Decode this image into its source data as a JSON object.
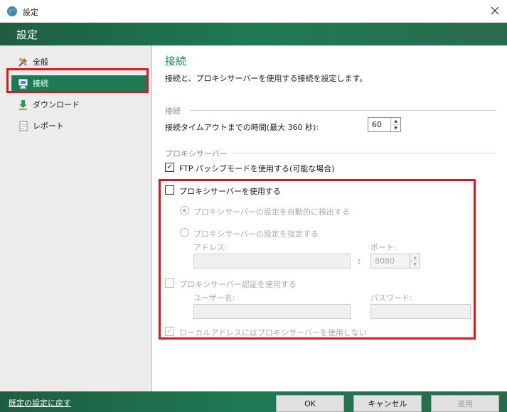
{
  "window": {
    "title": "設定",
    "icon": "globe-icon"
  },
  "header": {
    "title": "設定"
  },
  "sidebar": {
    "items": [
      {
        "label": "全般",
        "icon": "tools-icon"
      },
      {
        "label": "接続",
        "icon": "network-computer-icon",
        "active": true
      },
      {
        "label": "ダウンロード",
        "icon": "download-icon"
      },
      {
        "label": "レポート",
        "icon": "report-icon"
      }
    ]
  },
  "main": {
    "title": "接続",
    "description": "接続と、プロキシサーバーを使用する接続を設定します。",
    "connection": {
      "section": "接続",
      "timeout_label": "接続タイムアウトまでの時間(最大 360 秒):",
      "timeout_value": "60"
    },
    "proxy": {
      "section": "プロキシサーバー",
      "ftp_passive_label": "FTP パッシブモードを使用する(可能な場合)",
      "ftp_passive_checked": true,
      "use_proxy_label": "プロキシサーバーを使用する",
      "use_proxy_checked": false,
      "auto_detect_label": "プロキシサーバーの設定を自動的に検出する",
      "manual_label": "プロキシサーバーの設定を指定する",
      "address_label": "アドレス:",
      "address_value": "",
      "colon": ":",
      "port_label": "ポート:",
      "port_value": "8080",
      "auth_label": "プロキシサーバー認証を使用する",
      "auth_checked": false,
      "username_label": "ユーザー名:",
      "username_value": "",
      "password_label": "パスワード:",
      "password_value": "",
      "bypass_local_label": "ローカルアドレスにはプロキシサーバーを使用しない",
      "bypass_local_checked": true
    }
  },
  "footer": {
    "reset_label": "既定の設定に戻す",
    "ok_label": "OK",
    "cancel_label": "キャンセル",
    "apply_label": "適用"
  },
  "colors": {
    "accent": "#1c7a55",
    "highlight": "#e0161c",
    "title_green": "#1c8a63"
  }
}
